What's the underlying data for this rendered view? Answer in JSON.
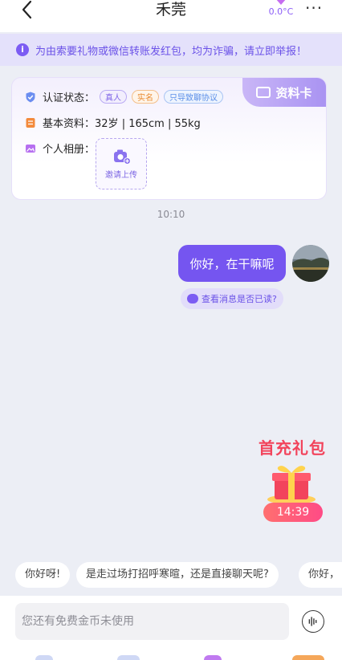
{
  "header": {
    "title": "禾莞",
    "temperature": "0.0°C",
    "more_label": "···"
  },
  "notice": {
    "icon": "info-icon",
    "text": "为由索要礼物或微信转账发红包，均为诈骗，请立即举报！"
  },
  "profile_card": {
    "tag_label": "资料卡",
    "verify": {
      "label": "认证状态：",
      "badges": [
        "真人",
        "实名",
        "只导致聊协议"
      ]
    },
    "basic": {
      "label": "基本资料：",
      "value": "32岁 | 165cm | 55kg"
    },
    "album": {
      "label": "个人相册：",
      "upload_label": "邀请上传"
    }
  },
  "chat": {
    "time": "10:10",
    "messages": [
      {
        "from": "me",
        "text": "你好，在干嘛呢"
      }
    ],
    "read_check": "查看消息是否已读?"
  },
  "gift": {
    "title": "首充礼包",
    "timer": "14:39"
  },
  "suggestions": [
    "你好呀!",
    "是走过场打招呼寒暄，还是直接聊天呢?",
    "你好，"
  ],
  "composer": {
    "placeholder": "您还有免费金币未使用"
  },
  "colors": {
    "accent": "#7555f0",
    "notice_bg": "#e4e1fb",
    "gift_red": "#f2445c"
  }
}
